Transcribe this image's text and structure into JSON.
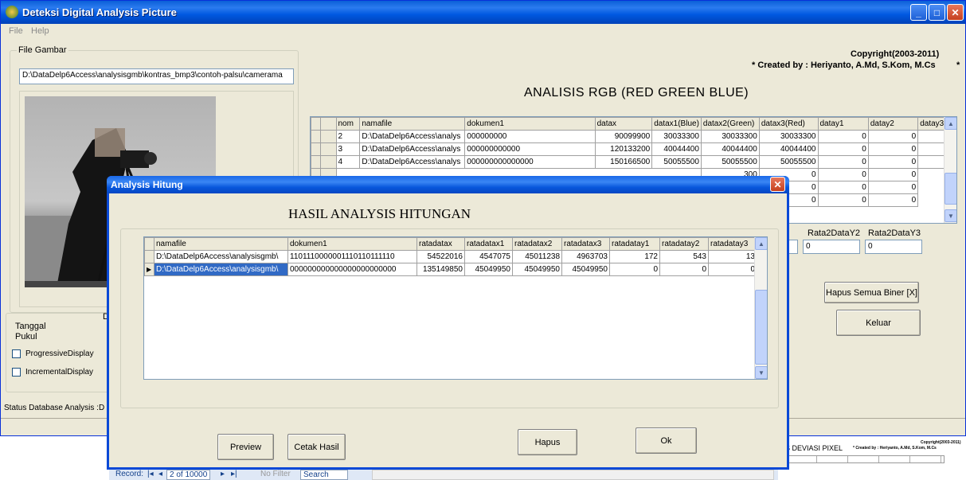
{
  "main_window": {
    "title": "Deteksi Digital Analysis Picture",
    "menu": [
      "File",
      "Help"
    ],
    "file_group_label": "File Gambar",
    "file_path": "D:\\DataDelp6Access\\analysisgmb\\kontras_bmp3\\contoh-palsu\\camerama",
    "copyright": "Copyright(2003-2011)",
    "created_by": "* Created by : Heriyanto, A.Md, S.Kom, M.Cs",
    "star": "*",
    "analysis_title": "ANALISIS RGB (RED GREEN BLUE)",
    "tanggal_label": "Tanggal",
    "pukul_label": "Pukul",
    "d_label": "D",
    "progressive_label": "ProgressiveDisplay",
    "incremental_label": "IncrementalDisplay",
    "status_label": "Status Database Analysis :D",
    "rata2_y2_label": "Rata2DataY2",
    "rata2_y3_label": "Rata2DataY3",
    "rata2_y2_value": "0",
    "rata2_y3_value": "0",
    "hapus_semua_label": "Hapus Semua Biner [X]",
    "keluar_label": "Keluar",
    "rgb_grid": {
      "headers": [
        "nom",
        "namafile",
        "dokumen1",
        "datax",
        "datax1(Blue)",
        "datax2(Green)",
        "datax3(Red)",
        "datay1",
        "datay2",
        "datay3"
      ],
      "rows": [
        [
          "2",
          "D:\\DataDelp6Access\\analys",
          "000000000",
          "90099900",
          "30033300",
          "30033300",
          "30033300",
          "0",
          "0",
          "0"
        ],
        [
          "3",
          "D:\\DataDelp6Access\\analys",
          "000000000000",
          "120133200",
          "40044400",
          "40044400",
          "40044400",
          "0",
          "0",
          "0"
        ],
        [
          "4",
          "D:\\DataDelp6Access\\analys",
          "000000000000000",
          "150166500",
          "50055500",
          "50055500",
          "50055500",
          "0",
          "0",
          "0"
        ]
      ],
      "hidden_rows_tail": [
        [
          "300",
          "0",
          "0",
          "0"
        ],
        [
          "00",
          "0",
          "0",
          "0"
        ],
        [
          "00",
          "0",
          "0",
          "0"
        ]
      ]
    }
  },
  "dialog": {
    "title": "Analysis Hitung",
    "heading": "HASIL ANALYSIS HITUNGAN",
    "headers": [
      "namafile",
      "dokumen1",
      "ratadatax",
      "ratadatax1",
      "ratadatax2",
      "ratadatax3",
      "ratadatay1",
      "ratadatay2",
      "ratadatay3"
    ],
    "rows": [
      [
        "D:\\DataDelp6Access\\analysisgmb\\",
        "1101110000001110110111110",
        "54522016",
        "4547075",
        "45011238",
        "4963703",
        "172",
        "543",
        "13"
      ],
      [
        "D:\\DataDelp6Access\\analysisgmb\\",
        "000000000000000000000000",
        "135149850",
        "45049950",
        "45049950",
        "45049950",
        "0",
        "0",
        "0"
      ]
    ],
    "preview_label": "Preview",
    "cetak_label": "Cetak Hasil",
    "hapus_label": "Hapus",
    "ok_label": "Ok"
  },
  "background_window": {
    "deviasi_text": "S DEVIASI PIXEL",
    "created_small": "* Created by : Heriyanto, A.Md, S.Kom, M.Cs",
    "copyright_small": "Copyright(2003-2011)"
  },
  "record_bar": {
    "record_label": "Record:",
    "position": "2 of 10000",
    "no_filter": "No Filter",
    "search": "Search"
  }
}
